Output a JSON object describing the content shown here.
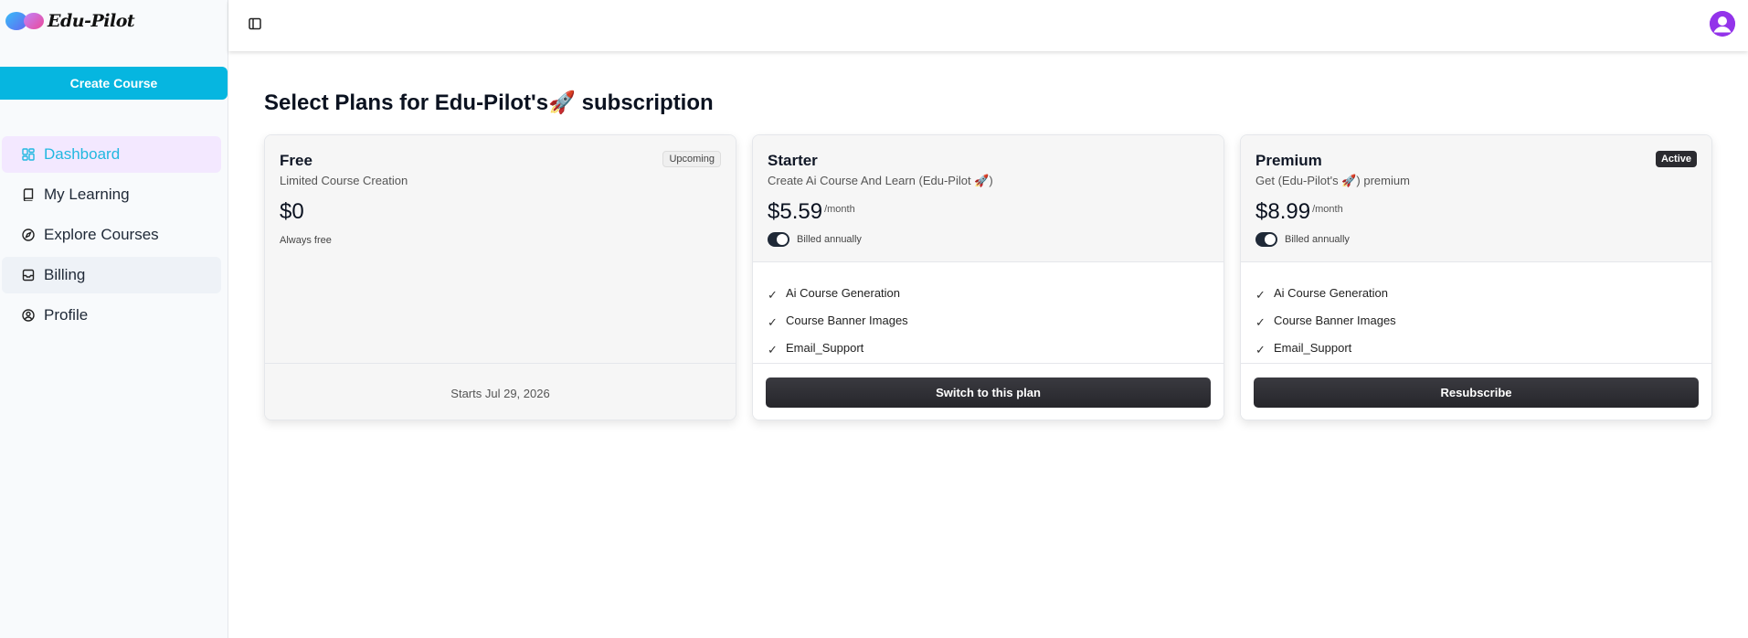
{
  "app": {
    "name": "Edu-Pilot"
  },
  "sidebar": {
    "create_label": "Create Course",
    "items": [
      {
        "label": "Dashboard",
        "icon": "dashboard-icon"
      },
      {
        "label": "My Learning",
        "icon": "book-icon"
      },
      {
        "label": "Explore Courses",
        "icon": "compass-icon"
      },
      {
        "label": "Billing",
        "icon": "inbox-icon"
      },
      {
        "label": "Profile",
        "icon": "user-circle-icon"
      }
    ]
  },
  "header": {
    "toggle_icon": "sidebar-toggle-icon",
    "avatar_icon": "user-avatar-icon"
  },
  "main": {
    "title": "Select Plans for Edu-Pilot's🚀 subscription",
    "plans": [
      {
        "name": "Free",
        "description": "Limited Course Creation",
        "price": "$0",
        "note": "Always free",
        "badge": "Upcoming",
        "footer_text": "Starts Jul 29, 2026"
      },
      {
        "name": "Starter",
        "description": "Create Ai Course And Learn (Edu-Pilot 🚀)",
        "price": "$5.59",
        "period": "/month",
        "billing_label": "Billed annually",
        "features": [
          "Ai Course Generation",
          "Course Banner Images",
          "Email_Support"
        ],
        "button_label": "Switch to this plan"
      },
      {
        "name": "Premium",
        "description": "Get (Edu-Pilot's 🚀) premium",
        "price": "$8.99",
        "period": "/month",
        "billing_label": "Billed annually",
        "badge": "Active",
        "features": [
          "Ai Course Generation",
          "Course Banner Images",
          "Email_Support"
        ],
        "button_label": "Resubscribe"
      }
    ]
  },
  "colors": {
    "accent": "#06b6e0",
    "active_nav_bg": "#f3e8ff",
    "dark_button": "#2b2b30"
  }
}
